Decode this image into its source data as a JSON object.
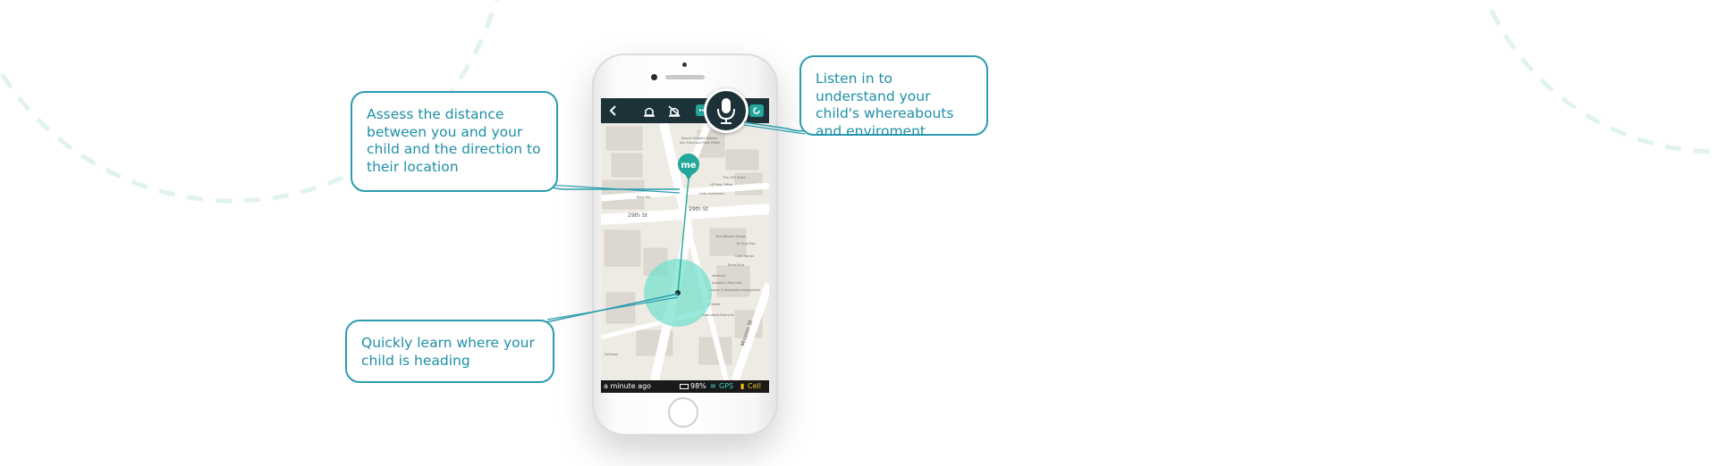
{
  "callouts": {
    "assess": "Assess the distance between you and your child and the direction to their location",
    "listen": "Listen in to understand your child's whereabouts and enviroment",
    "learn": "Quickly learn where your child is heading"
  },
  "app": {
    "topbar": {
      "back_icon": "chevron-left-icon",
      "icons": [
        "alarm-icon",
        "alarm-off-icon",
        "chat-icon",
        "microphone-icon",
        "refresh-icon"
      ]
    },
    "map": {
      "me_label": "me",
      "street_1": "29th St",
      "street_2": "29th St",
      "street_3": "Mission St",
      "poi": [
        "Bernal Heights Station",
        "San Francisco Post Office",
        "Rock Bar",
        "Cafe Anesthetic",
        "US Post Office",
        "The UPS Store",
        "Cafe Hardin",
        "The Watson School",
        "El Gran Rey",
        "Pizza Kind",
        "Valencia",
        "Aquatic's Pool Hall",
        "Lawyer & Associate Immigration",
        "La Wolfe",
        "Automated Financial",
        "Safeway"
      ]
    },
    "status": {
      "updated": "a minute ago",
      "battery": "98%",
      "gps": "GPS",
      "cell": "Cell"
    }
  },
  "colors": {
    "accent": "#1f8fa6",
    "me_marker": "#24a79a",
    "radius_fill": "#6fe0cc",
    "topbar": "#1d3238"
  }
}
